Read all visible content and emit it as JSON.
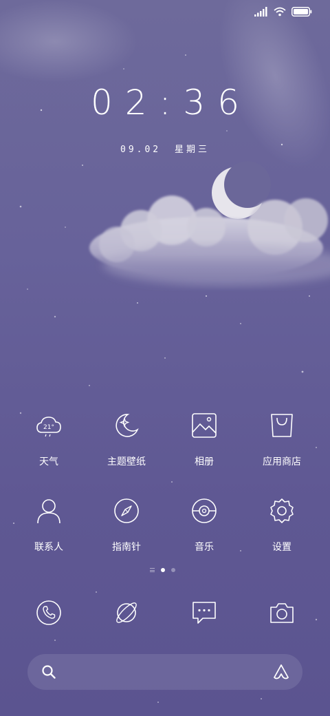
{
  "status_bar": {
    "signal_icon": "signal-icon",
    "wifi_icon": "wifi-icon",
    "battery_icon": "battery-icon",
    "battery_level": 1.0
  },
  "lock": {
    "time": "02:36",
    "date": "09.02",
    "weekday": "星期三"
  },
  "wallpaper": {
    "moon_icon": "crescent-moon",
    "cloud_icon": "cloud"
  },
  "apps_row1": [
    {
      "label": "天气",
      "icon": "weather-cloud-icon",
      "temp": "21°"
    },
    {
      "label": "主题壁纸",
      "icon": "theme-moon-icon"
    },
    {
      "label": "相册",
      "icon": "gallery-icon"
    },
    {
      "label": "应用商店",
      "icon": "shopping-bag-icon"
    }
  ],
  "apps_row2": [
    {
      "label": "联系人",
      "icon": "contact-person-icon"
    },
    {
      "label": "指南针",
      "icon": "compass-icon"
    },
    {
      "label": "音乐",
      "icon": "music-disc-icon"
    },
    {
      "label": "设置",
      "icon": "gear-icon"
    }
  ],
  "page_indicator": {
    "pages": 2,
    "active": 1
  },
  "dock": [
    {
      "name": "phone",
      "icon": "phone-icon"
    },
    {
      "name": "browser",
      "icon": "planet-icon"
    },
    {
      "name": "messages",
      "icon": "message-icon"
    },
    {
      "name": "camera",
      "icon": "camera-icon"
    }
  ],
  "search": {
    "search_icon": "search-icon",
    "assistant_icon": "assistant-icon"
  },
  "colors": {
    "background": "#635d96",
    "foreground": "#ffffff"
  }
}
